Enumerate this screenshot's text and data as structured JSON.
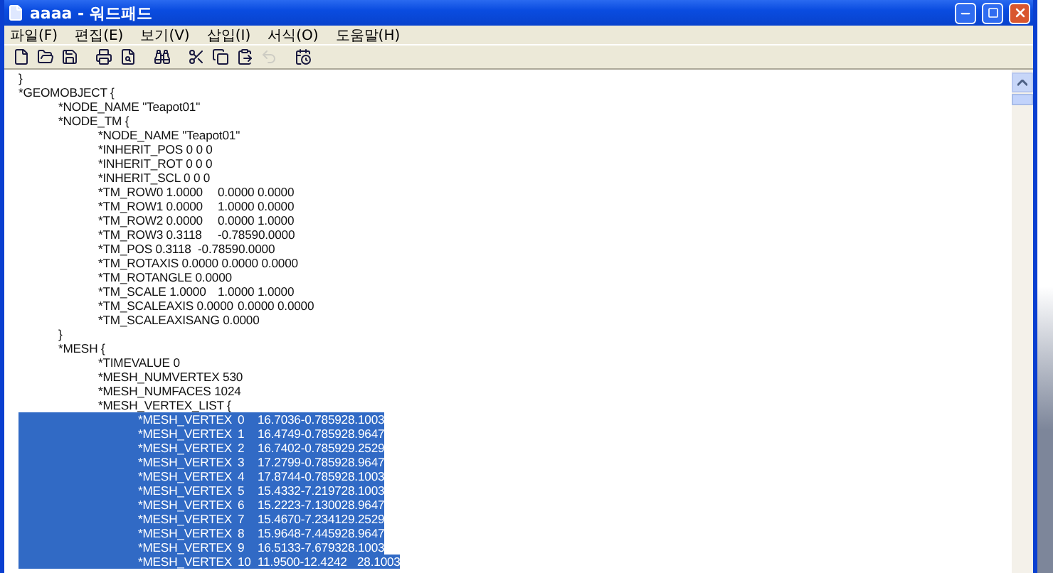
{
  "window": {
    "title": "aaaa - 워드패드"
  },
  "menu": [
    {
      "label": "파일(F)"
    },
    {
      "label": "편집(E)"
    },
    {
      "label": "보기(V)"
    },
    {
      "label": "삽입(I)"
    },
    {
      "label": "서식(O)"
    },
    {
      "label": "도움말(H)"
    }
  ],
  "toolbar": [
    {
      "kind": "new",
      "disabled": false
    },
    {
      "kind": "open",
      "disabled": false
    },
    {
      "kind": "save",
      "disabled": false
    },
    {
      "kind": "sep"
    },
    {
      "kind": "print",
      "disabled": false
    },
    {
      "kind": "preview",
      "disabled": false
    },
    {
      "kind": "sep"
    },
    {
      "kind": "find",
      "disabled": false
    },
    {
      "kind": "sep"
    },
    {
      "kind": "cut",
      "disabled": false
    },
    {
      "kind": "copy",
      "disabled": false
    },
    {
      "kind": "paste",
      "disabled": false
    },
    {
      "kind": "undo",
      "disabled": true
    },
    {
      "kind": "sep"
    },
    {
      "kind": "datetime",
      "disabled": false
    }
  ],
  "document": {
    "lines": [
      {
        "cells": [
          "}"
        ],
        "selected": false
      },
      {
        "cells": [
          "*GEOMOBJECT {"
        ],
        "selected": false,
        "children": [
          {
            "cells": [
              "*NODE_NAME \"Teapot01\""
            ],
            "selected": false
          },
          {
            "cells": [
              "*NODE_TM {"
            ],
            "selected": false,
            "children": [
              {
                "cells": [
                  "*NODE_NAME \"Teapot01\""
                ],
                "selected": false
              },
              {
                "cells": [
                  "*INHERIT_POS 0 0 0"
                ],
                "selected": false
              },
              {
                "cells": [
                  "*INHERIT_ROT 0 0 0"
                ],
                "selected": false
              },
              {
                "cells": [
                  "*INHERIT_SCL 0 0 0"
                ],
                "selected": false
              },
              {
                "cells": [
                  "*TM_ROW0 1.0000",
                  "0.0000 0.0000"
                ],
                "selected": false
              },
              {
                "cells": [
                  "*TM_ROW1 0.0000",
                  "1.0000 0.0000"
                ],
                "selected": false
              },
              {
                "cells": [
                  "*TM_ROW2 0.0000",
                  "0.0000 1.0000"
                ],
                "selected": false
              },
              {
                "cells": [
                  "*TM_ROW3 0.3118",
                  "-0.78590.0000"
                ],
                "selected": false
              },
              {
                "cells": [
                  "*TM_POS 0.3118",
                  "-0.78590.0000"
                ],
                "selected": false
              },
              {
                "cells": [
                  "*TM_ROTAXIS 0.0000 0.0000 0.0000"
                ],
                "selected": false
              },
              {
                "cells": [
                  "*TM_ROTANGLE 0.0000"
                ],
                "selected": false
              },
              {
                "cells": [
                  "*TM_SCALE 1.0000",
                  "1.0000 1.0000"
                ],
                "selected": false
              },
              {
                "cells": [
                  "*TM_SCALEAXIS 0.0000",
                  "0.0000 0.0000"
                ],
                "selected": false
              },
              {
                "cells": [
                  "*TM_SCALEAXISANG 0.0000"
                ],
                "selected": false
              }
            ]
          },
          {
            "cells": [
              "}"
            ],
            "selected": false
          },
          {
            "cells": [
              "*MESH {"
            ],
            "selected": false,
            "children": [
              {
                "cells": [
                  "*TIMEVALUE 0"
                ],
                "selected": false
              },
              {
                "cells": [
                  "*MESH_NUMVERTEX 530"
                ],
                "selected": false
              },
              {
                "cells": [
                  "*MESH_NUMFACES 1024"
                ],
                "selected": false
              },
              {
                "cells": [
                  "*MESH_VERTEX_LIST {"
                ],
                "selected": false,
                "children": [
                  {
                    "cells": [
                      "*MESH_VERTEX",
                      "0",
                      "16.7036-0.785928.1003"
                    ],
                    "selected": true
                  },
                  {
                    "cells": [
                      "*MESH_VERTEX",
                      "1",
                      "16.4749-0.785928.9647"
                    ],
                    "selected": true
                  },
                  {
                    "cells": [
                      "*MESH_VERTEX",
                      "2",
                      "16.7402-0.785929.2529"
                    ],
                    "selected": true
                  },
                  {
                    "cells": [
                      "*MESH_VERTEX",
                      "3",
                      "17.2799-0.785928.9647"
                    ],
                    "selected": true
                  },
                  {
                    "cells": [
                      "*MESH_VERTEX",
                      "4",
                      "17.8744-0.785928.1003"
                    ],
                    "selected": true
                  },
                  {
                    "cells": [
                      "*MESH_VERTEX",
                      "5",
                      "15.4332-7.219728.1003"
                    ],
                    "selected": true
                  },
                  {
                    "cells": [
                      "*MESH_VERTEX",
                      "6",
                      "15.2223-7.130028.9647"
                    ],
                    "selected": true
                  },
                  {
                    "cells": [
                      "*MESH_VERTEX",
                      "7",
                      "15.4670-7.234129.2529"
                    ],
                    "selected": true
                  },
                  {
                    "cells": [
                      "*MESH_VERTEX",
                      "8",
                      "15.9648-7.445928.9647"
                    ],
                    "selected": true
                  },
                  {
                    "cells": [
                      "*MESH_VERTEX",
                      "9",
                      "16.5133-7.679328.1003"
                    ],
                    "selected": true
                  },
                  {
                    "cells": [
                      "*MESH_VERTEX",
                      "10",
                      "11.9500-12.4242",
                      "28.1003"
                    ],
                    "selected": true
                  }
                ]
              }
            ]
          }
        ]
      }
    ]
  }
}
